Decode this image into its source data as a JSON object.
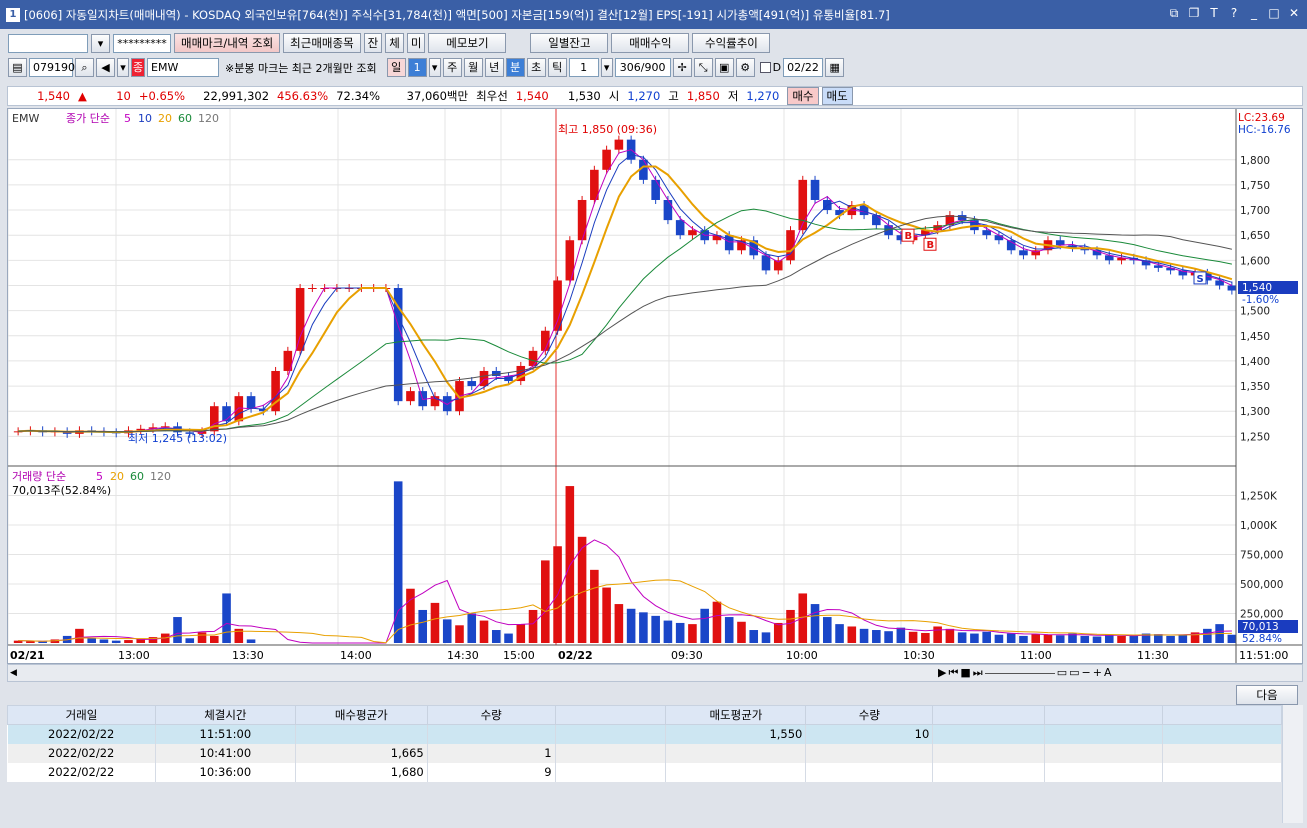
{
  "titlebar": {
    "num": "1",
    "text": "[0606] 자동일지차트(매매내역) - KOSDAQ 외국인보유[764(천)] 주식수[31,784(천)] 액면[500] 자본금[159(억)] 결산[12월] EPS[-191] 시가총액[491(억)] 유통비율[81.7]"
  },
  "toolbar1": {
    "account_value": "",
    "password_mask": "*********",
    "btn_mark": "매매마크/내역 조회",
    "btn_recent": "최근매매종목",
    "btn_jan": "잔",
    "btn_che": "체",
    "btn_mi": "미",
    "btn_memo": "메모보기",
    "btn_daily": "일별잔고",
    "btn_profit": "매매수익",
    "btn_rate": "수익률추이"
  },
  "toolbar2": {
    "code": "079190",
    "stock_name": "EMW",
    "note": "※분봉 마크는 최근 2개월만 조회",
    "period_il": "일",
    "period_num": "1",
    "ju": "주",
    "wol": "월",
    "nyeon": "년",
    "bun": "분",
    "cho": "초",
    "tik": "틱",
    "unit": "1",
    "count": "306/900",
    "d_label": "D",
    "date": "02/22"
  },
  "quote": {
    "price": "1,540",
    "arrow": "▲",
    "change": "10",
    "rate": "+0.65%",
    "volume": "22,991,302",
    "vol_rate": "456.63%",
    "ratio": "72.34%",
    "amount": "37,060백만",
    "best_label": "최우선",
    "bid": "1,540",
    "ask": "1,530",
    "open_label": "시",
    "open": "1,270",
    "high_label": "고",
    "high": "1,850",
    "low_label": "저",
    "low": "1,270",
    "buy_btn": "매수",
    "sell_btn": "매도"
  },
  "chart_data": {
    "type": "candlestick",
    "price_legend": "EMW",
    "ma_legend_prefix": "종가 단순",
    "ma_periods": [
      "5",
      "10",
      "20",
      "60",
      "120"
    ],
    "lc": "LC:23.69",
    "hc": "HC:-16.76",
    "y_ticks": [
      "1,800",
      "1,750",
      "1,700",
      "1,650",
      "1,600",
      "1,550",
      "1,500",
      "1,450",
      "1,400",
      "1,350",
      "1,300",
      "1,250"
    ],
    "y_range": [
      1205,
      1885
    ],
    "last_price_label": "1,540",
    "last_rate_label": "-1.60%",
    "high_annotation": "최고 1,850 (09:36)",
    "low_annotation": "최저 1,245 (13:02)",
    "vol_legend_prefix": "거래량 단순",
    "vol_ma_periods": [
      "5",
      "20",
      "60",
      "120"
    ],
    "vol_info": "70,013주(52.84%)",
    "vol_ticks": [
      "1,250K",
      "1,000K",
      "750,000",
      "500,000",
      "250,000"
    ],
    "vol_range": [
      0,
      1390000
    ],
    "vol_last_label": "70,013",
    "vol_last_rate": "52.84%",
    "x_labels": [
      "02/21",
      "13:00",
      "13:30",
      "14:00",
      "14:30",
      "15:00",
      "02/22",
      "09:30",
      "10:00",
      "10:30",
      "11:00",
      "11:30",
      "11:51:00"
    ],
    "close_series": [
      1260,
      1262,
      1258,
      1260,
      1255,
      1262,
      1260,
      1258,
      1256,
      1262,
      1265,
      1268,
      1270,
      1258,
      1255,
      1260,
      1310,
      1280,
      1330,
      1305,
      1300,
      1380,
      1420,
      1545,
      1545,
      1545,
      1545,
      1545,
      1545,
      1545,
      1545,
      1320,
      1340,
      1310,
      1330,
      1300,
      1360,
      1350,
      1380,
      1370,
      1360,
      1390,
      1420,
      1460,
      1560,
      1640,
      1720,
      1780,
      1820,
      1840,
      1800,
      1760,
      1720,
      1680,
      1650,
      1660,
      1640,
      1650,
      1620,
      1640,
      1610,
      1580,
      1600,
      1660,
      1760,
      1720,
      1700,
      1690,
      1710,
      1690,
      1670,
      1650,
      1640,
      1650,
      1660,
      1670,
      1690,
      1680,
      1660,
      1650,
      1640,
      1620,
      1610,
      1620,
      1640,
      1630,
      1625,
      1620,
      1610,
      1600,
      1605,
      1600,
      1590,
      1585,
      1580,
      1570,
      1575,
      1560,
      1550,
      1540
    ],
    "volume_series": [
      20000,
      15000,
      12000,
      30000,
      60000,
      120000,
      40000,
      30000,
      20000,
      25000,
      35000,
      50000,
      80000,
      220000,
      40000,
      90000,
      60000,
      420000,
      120000,
      30000,
      0,
      0,
      0,
      0,
      0,
      0,
      0,
      0,
      0,
      0,
      0,
      1370000,
      460000,
      280000,
      340000,
      200000,
      150000,
      250000,
      190000,
      110000,
      80000,
      160000,
      280000,
      700000,
      820000,
      1330000,
      900000,
      620000,
      470000,
      330000,
      290000,
      260000,
      230000,
      190000,
      170000,
      160000,
      290000,
      350000,
      220000,
      180000,
      110000,
      90000,
      170000,
      280000,
      420000,
      330000,
      220000,
      160000,
      140000,
      120000,
      110000,
      100000,
      130000,
      95000,
      85000,
      140000,
      120000,
      90000,
      80000,
      95000,
      70000,
      80000,
      60000,
      75000,
      70000,
      65000,
      80000,
      60000,
      55000,
      70000,
      60000,
      65000,
      80000,
      75000,
      60000,
      70000,
      90000,
      120000,
      160000,
      70013
    ],
    "markers": [
      {
        "label": "B",
        "price": 1650
      },
      {
        "label": "B",
        "price": 1632
      },
      {
        "label": "S",
        "price": 1565
      }
    ]
  },
  "scroll": {
    "next_btn": "다음"
  },
  "trades": {
    "headers": [
      "거래일",
      "체결시간",
      "매수평균가",
      "수량",
      "",
      "매도평균가",
      "수량",
      "",
      "",
      ""
    ],
    "rows": [
      [
        "2022/02/22",
        "11:51:00",
        "",
        "",
        "",
        "1,550",
        "10",
        "",
        "",
        ""
      ],
      [
        "2022/02/22",
        "10:41:00",
        "1,665",
        "1",
        "",
        "",
        "",
        "",
        "",
        ""
      ],
      [
        "2022/02/22",
        "10:36:00",
        "1,680",
        "9",
        "",
        "",
        "",
        "",
        "",
        ""
      ]
    ]
  },
  "colors": {
    "up": "#e01010",
    "down": "#1a46c8",
    "ma5": "#c000c0",
    "ma10": "#1a3cbf",
    "ma20": "#e8a000",
    "ma60": "#1a8a3a",
    "ma120": "#555555"
  }
}
